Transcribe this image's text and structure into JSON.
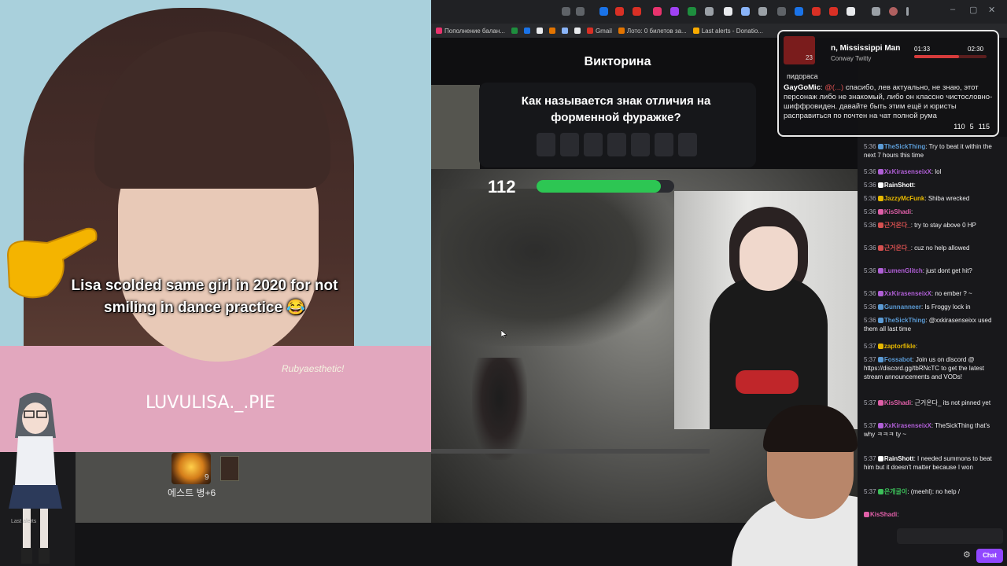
{
  "browser": {
    "bookmarks": [
      "Пополнение балан...",
      "Gmail",
      "Лото: 0 билетов за...",
      "Last alerts - Donatio..."
    ],
    "window_controls": [
      "–",
      "▢",
      "✕"
    ]
  },
  "quiz": {
    "title": "Викторина",
    "question": "Как называется знак отличия на форменной фуражке?",
    "answer_letters": 7,
    "timer": "112",
    "timer_fill_fraction": 0.9
  },
  "video": {
    "caption": "Lisa scolded same girl in 2020 for not smiling in dance practice 😂",
    "watermark": "LUVULISA._.PIE",
    "credit": "Rubyaesthetic!"
  },
  "game_hud": {
    "item_count": "9",
    "item_label": "에스트 병+6"
  },
  "vtuber": {
    "alerts_label": "Last alerts"
  },
  "music": {
    "title": "n, Mississippi Man",
    "artist": "Conway Twitty",
    "elapsed": "01:33",
    "total": "02:30",
    "progress_fraction": 0.62,
    "cover_num": "23",
    "prev_msg": "пидораса",
    "msg_user": "GayGoMic",
    "msg_mention": "@(...)",
    "msg_text": "спасибо, лев актуально, не знаю, этот персонаж либо не знакомый, либо он классно чистословно-шиффровиден. давайте быть этим ещё и юристы расправиться по почтен на чат полной рума",
    "stats": [
      "110",
      "5",
      "115"
    ]
  },
  "chat": {
    "messages": [
      {
        "time": "5:36",
        "user": "TheSickThing",
        "color": "#5b9bd5",
        "text": "Try to beat it within the next 7 hours this time"
      },
      {
        "time": "5:36",
        "user": "XxKirasenseixX",
        "color": "#b05fd6",
        "text": "lol"
      },
      {
        "time": "5:36",
        "user": "RainShott",
        "color": "#ffffff",
        "text": ""
      },
      {
        "time": "5:36",
        "user": "JazzyMcFunk",
        "color": "#e6b800",
        "text": "Shiba wrecked"
      },
      {
        "time": "5:36",
        "user": "KisShadi",
        "color": "#e05fa8",
        "text": ""
      },
      {
        "time": "5:36",
        "user": "근거온다_",
        "color": "#d65050",
        "text": "try to stay above 0 HP"
      },
      {
        "time": "5:36",
        "user": "근거온다_",
        "color": "#d65050",
        "text": "cuz no help allowed"
      },
      {
        "time": "5:36",
        "user": "LumenGlitch",
        "color": "#b05fd6",
        "text": "just dont get hit?"
      },
      {
        "time": "5:36",
        "user": "XxKirasenseixX",
        "color": "#b05fd6",
        "text": "no ember ? ~"
      },
      {
        "time": "5:36",
        "user": "Gunnanneer",
        "color": "#5b9bd5",
        "text": "Is Froggy lock in"
      },
      {
        "time": "5:36",
        "user": "TheSickThing",
        "color": "#5b9bd5",
        "text": "@xxkirasenseixx used them all last time"
      },
      {
        "time": "5:37",
        "user": "zaptorfikle",
        "color": "#e6b800",
        "text": ""
      },
      {
        "time": "5:37",
        "user": "Fossabot",
        "color": "#5b9bd5",
        "text": "Join us on discord @ https://discord.gg/tbRNcTC to get the latest stream announcements and VODs!"
      },
      {
        "time": "5:37",
        "user": "KisShadi",
        "color": "#e05fa8",
        "text": "근거온다_ its not pinned yet"
      },
      {
        "time": "5:37",
        "user": "XxKirasenseixX",
        "color": "#b05fd6",
        "text": "TheSickThing that's why ㅋㅋㅋ ty ~"
      },
      {
        "time": "5:37",
        "user": "RainShott",
        "color": "#ffffff",
        "text": "I needed summons to beat him but it doesn't matter because I won"
      },
      {
        "time": "5:37",
        "user": "은개굴이",
        "color": "#3cbf5a",
        "text": "(meehl): no help /"
      },
      {
        "time": "",
        "user": "KisShadi",
        "color": "#e05fa8",
        "text": ""
      }
    ],
    "send_label": "Chat"
  }
}
